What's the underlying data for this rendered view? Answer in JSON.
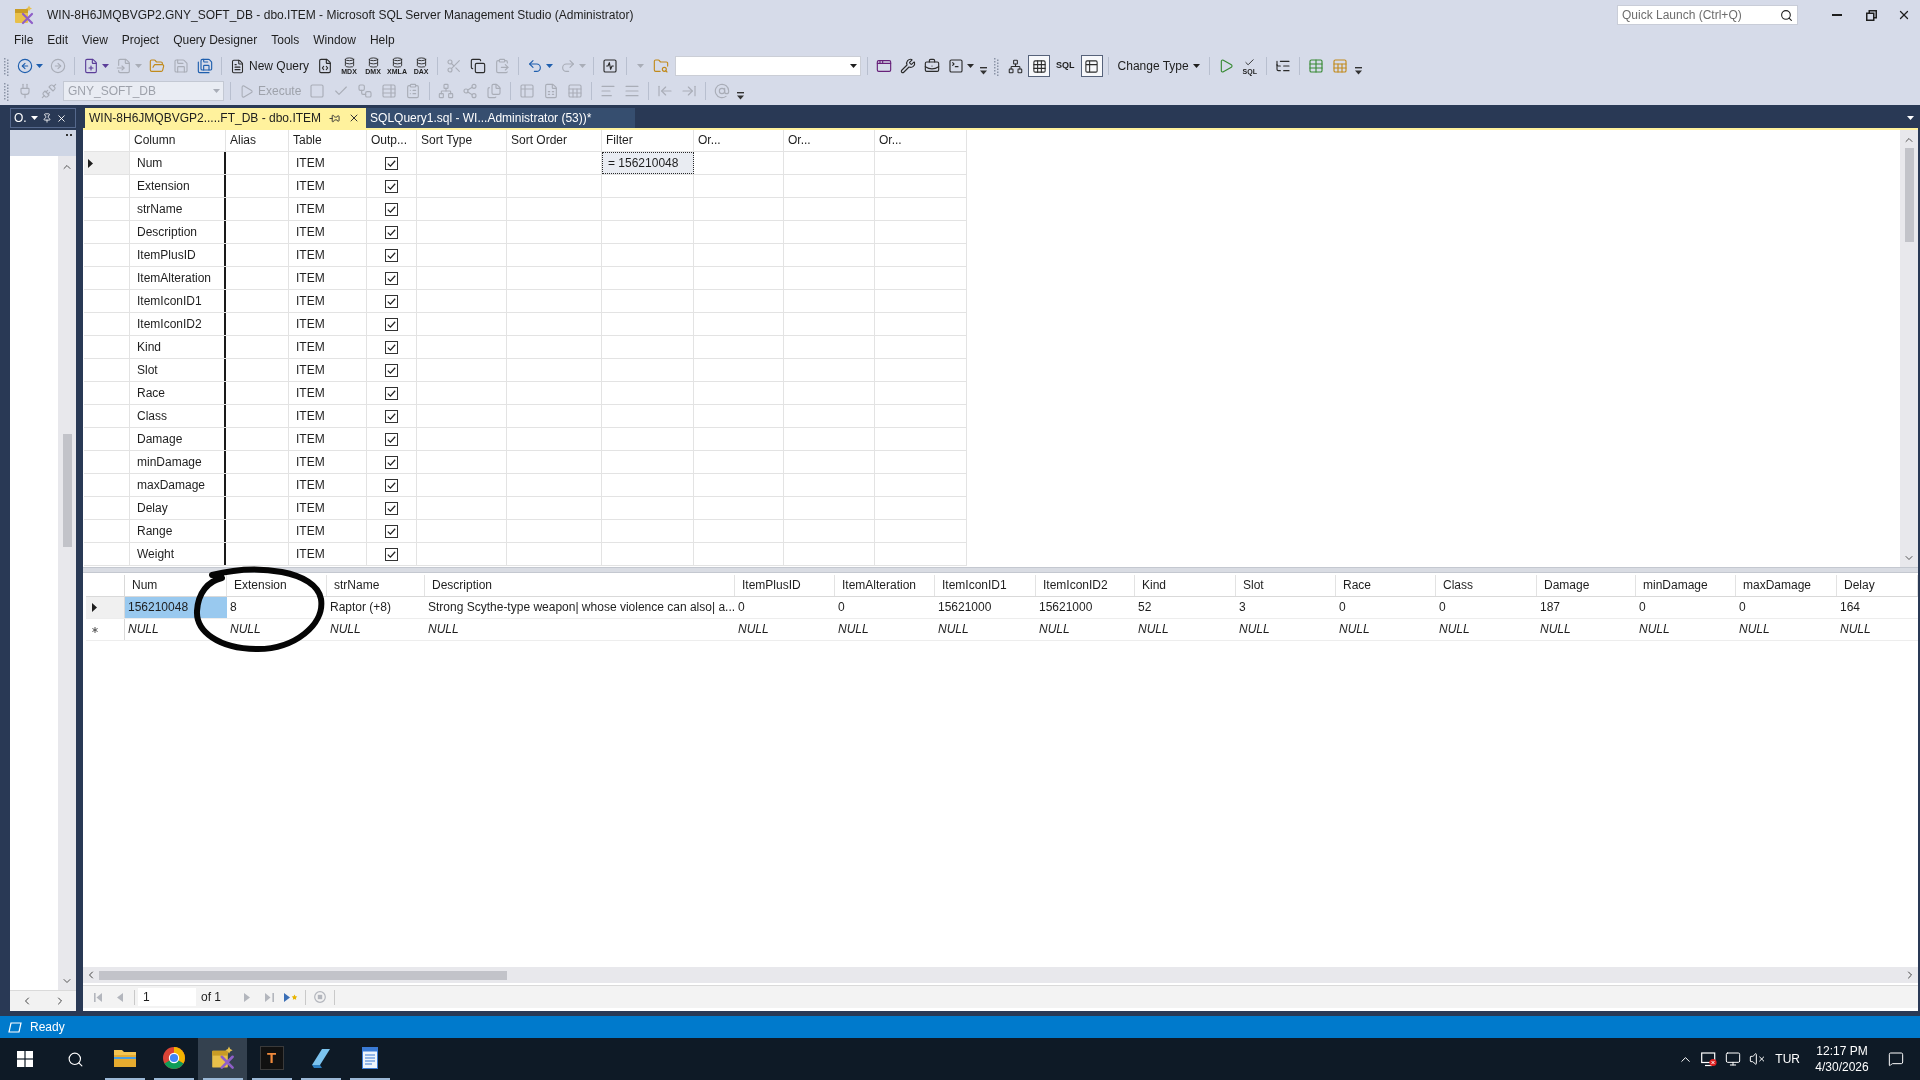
{
  "window": {
    "title": "WIN-8H6JMQBVGP2.GNY_SOFT_DB - dbo.ITEM - Microsoft SQL Server Management Studio (Administrator)",
    "quick_launch": {
      "placeholder": "Quick Launch (Ctrl+Q)"
    }
  },
  "menu": [
    {
      "label": "File"
    },
    {
      "label": "Edit"
    },
    {
      "label": "View"
    },
    {
      "label": "Project"
    },
    {
      "label": "Query Designer"
    },
    {
      "label": "Tools"
    },
    {
      "label": "Window"
    },
    {
      "label": "Help"
    }
  ],
  "standard_toolbar": [
    [
      {
        "kind": "split",
        "disabled": false
      },
      {
        "kind": "icon",
        "disabled": true
      }
    ],
    [
      {
        "kind": "split",
        "disabled": false
      },
      {
        "kind": "split",
        "disabled": true
      },
      {
        "kind": "icon",
        "disabled": false
      },
      {
        "kind": "icon",
        "disabled": true
      },
      {
        "kind": "icon",
        "disabled": false
      }
    ],
    [
      {
        "kind": "button",
        "label": "New Query",
        "disabled": false
      },
      {
        "kind": "icon",
        "disabled": false
      },
      {
        "kind": "icon",
        "badge": "MDX",
        "disabled": false
      },
      {
        "kind": "icon",
        "badge": "DMX",
        "disabled": false
      },
      {
        "kind": "icon",
        "badge": "XMLA",
        "disabled": false
      },
      {
        "kind": "icon",
        "badge": "DAX",
        "disabled": false
      }
    ],
    [
      {
        "kind": "icon",
        "disabled": true
      },
      {
        "kind": "icon",
        "disabled": false
      },
      {
        "kind": "icon",
        "disabled": true
      }
    ],
    [
      {
        "kind": "split",
        "disabled": false
      },
      {
        "kind": "split",
        "disabled": true
      }
    ],
    [
      {
        "kind": "icon",
        "disabled": false
      }
    ],
    [
      {
        "kind": "menu",
        "disabled": true
      },
      {
        "kind": "icon",
        "disabled": false
      },
      {
        "kind": "combo",
        "disabled": false
      }
    ],
    [
      {
        "kind": "icon",
        "disabled": false
      },
      {
        "kind": "icon",
        "disabled": false
      },
      {
        "kind": "icon",
        "disabled": false
      },
      {
        "kind": "split",
        "disabled": false
      }
    ]
  ],
  "designer_toolbar": [
    [
      {
        "kind": "icon",
        "pressed": false
      },
      {
        "kind": "icon",
        "pressed": true
      },
      {
        "kind": "text",
        "label": "SQL",
        "pressed": false
      },
      {
        "kind": "icon",
        "pressed": true
      }
    ],
    [
      {
        "kind": "menu-button",
        "label": "Change Type"
      }
    ],
    [
      {
        "kind": "icon"
      },
      {
        "kind": "icon",
        "badge": "SQL"
      }
    ],
    [
      {
        "kind": "icon"
      }
    ],
    [
      {
        "kind": "icon"
      },
      {
        "kind": "icon"
      }
    ]
  ],
  "sql_toolbar": [
    [
      {
        "kind": "icon",
        "disabled": true
      },
      {
        "kind": "icon",
        "disabled": true
      },
      {
        "kind": "combo",
        "value": "GNY_SOFT_DB",
        "disabled": true
      }
    ],
    [
      {
        "kind": "button",
        "label": "Execute",
        "disabled": true
      },
      {
        "kind": "icon",
        "disabled": true
      },
      {
        "kind": "icon",
        "disabled": true
      },
      {
        "kind": "icon",
        "disabled": true
      },
      {
        "kind": "icon",
        "disabled": true
      },
      {
        "kind": "icon",
        "disabled": true
      }
    ],
    [
      {
        "kind": "icon",
        "disabled": true
      },
      {
        "kind": "icon",
        "disabled": true
      },
      {
        "kind": "icon",
        "disabled": true
      }
    ],
    [
      {
        "kind": "icon",
        "disabled": true
      },
      {
        "kind": "icon",
        "disabled": true
      },
      {
        "kind": "icon",
        "disabled": true
      }
    ],
    [
      {
        "kind": "icon",
        "disabled": true
      },
      {
        "kind": "icon",
        "disabled": true
      }
    ],
    [
      {
        "kind": "icon",
        "disabled": true
      },
      {
        "kind": "icon",
        "disabled": true
      }
    ],
    [
      {
        "kind": "icon",
        "disabled": true
      }
    ]
  ],
  "tool_window": {
    "title": "O."
  },
  "document_tabs": [
    {
      "label": "WIN-8H6JMQBVGP2.....FT_DB - dbo.ITEM",
      "selected": true
    },
    {
      "label": "SQLQuery1.sql - WI...Administrator (53))*",
      "selected": false
    }
  ],
  "criteria_grid": {
    "columns": [
      "Column",
      "Alias",
      "Table",
      "Outp...",
      "Sort Type",
      "Sort Order",
      "Filter",
      "Or...",
      "Or...",
      "Or..."
    ],
    "rows": [
      {
        "column": "Num",
        "table": "ITEM",
        "output": true,
        "current": true,
        "filter": {
          "value": "= 156210048",
          "focused": true
        }
      },
      {
        "column": "Extension",
        "table": "ITEM",
        "output": true,
        "current": false
      },
      {
        "column": "strName",
        "table": "ITEM",
        "output": true,
        "current": false
      },
      {
        "column": "Description",
        "table": "ITEM",
        "output": true,
        "current": false
      },
      {
        "column": "ItemPlusID",
        "table": "ITEM",
        "output": true,
        "current": false
      },
      {
        "column": "ItemAlteration",
        "table": "ITEM",
        "output": true,
        "current": false
      },
      {
        "column": "ItemIconID1",
        "table": "ITEM",
        "output": true,
        "current": false
      },
      {
        "column": "ItemIconID2",
        "table": "ITEM",
        "output": true,
        "current": false
      },
      {
        "column": "Kind",
        "table": "ITEM",
        "output": true,
        "current": false
      },
      {
        "column": "Slot",
        "table": "ITEM",
        "output": true,
        "current": false
      },
      {
        "column": "Race",
        "table": "ITEM",
        "output": true,
        "current": false
      },
      {
        "column": "Class",
        "table": "ITEM",
        "output": true,
        "current": false
      },
      {
        "column": "Damage",
        "table": "ITEM",
        "output": true,
        "current": false
      },
      {
        "column": "minDamage",
        "table": "ITEM",
        "output": true,
        "current": false
      },
      {
        "column": "maxDamage",
        "table": "ITEM",
        "output": true,
        "current": false
      },
      {
        "column": "Delay",
        "table": "ITEM",
        "output": true,
        "current": false
      },
      {
        "column": "Range",
        "table": "ITEM",
        "output": true,
        "current": false
      },
      {
        "column": "Weight",
        "table": "ITEM",
        "output": true,
        "current": false
      }
    ]
  },
  "results_grid": {
    "columns": [
      "Num",
      "Extension",
      "strName",
      "Description",
      "ItemPlusID",
      "ItemAlteration",
      "ItemIconID1",
      "ItemIconID2",
      "Kind",
      "Slot",
      "Race",
      "Class",
      "Damage",
      "minDamage",
      "maxDamage",
      "Delay"
    ],
    "rows": [
      {
        "kind": "data",
        "current": true,
        "cells": [
          {
            "value": "156210048",
            "selected": true
          },
          {
            "value": "8",
            "selected": false
          },
          {
            "value": "Raptor (+8)",
            "selected": false
          },
          {
            "value": "Strong Scythe-type weapon| whose violence can also| a...",
            "selected": false
          },
          {
            "value": "0",
            "selected": false
          },
          {
            "value": "0",
            "selected": false
          },
          {
            "value": "15621000",
            "selected": false
          },
          {
            "value": "15621000",
            "selected": false
          },
          {
            "value": "52",
            "selected": false
          },
          {
            "value": "3",
            "selected": false
          },
          {
            "value": "0",
            "selected": false
          },
          {
            "value": "0",
            "selected": false
          },
          {
            "value": "187",
            "selected": false
          },
          {
            "value": "0",
            "selected": false
          },
          {
            "value": "0",
            "selected": false
          },
          {
            "value": "164",
            "selected": false
          }
        ]
      },
      {
        "kind": "new",
        "current": false,
        "cells": [
          {
            "value": "NULL",
            "selected": false
          },
          {
            "value": "NULL",
            "selected": false
          },
          {
            "value": "NULL",
            "selected": false
          },
          {
            "value": "NULL",
            "selected": false
          },
          {
            "value": "NULL",
            "selected": false
          },
          {
            "value": "NULL",
            "selected": false
          },
          {
            "value": "NULL",
            "selected": false
          },
          {
            "value": "NULL",
            "selected": false
          },
          {
            "value": "NULL",
            "selected": false
          },
          {
            "value": "NULL",
            "selected": false
          },
          {
            "value": "NULL",
            "selected": false
          },
          {
            "value": "NULL",
            "selected": false
          },
          {
            "value": "NULL",
            "selected": false
          },
          {
            "value": "NULL",
            "selected": false
          },
          {
            "value": "NULL",
            "selected": false
          },
          {
            "value": "NULL",
            "selected": false
          }
        ]
      }
    ]
  },
  "pager": {
    "page": "1",
    "count": "of 1",
    "buttons": [
      {
        "disabled": true
      },
      {
        "disabled": true
      },
      {
        "disabled": true
      },
      {
        "disabled": true
      },
      {
        "disabled": false
      },
      {
        "disabled": true
      }
    ]
  },
  "status_bar": {
    "text": "Ready"
  },
  "taskbar": {
    "apps": [
      {
        "running": true,
        "active": false
      },
      {
        "running": true,
        "active": false
      },
      {
        "running": true,
        "active": true
      },
      {
        "running": true,
        "active": false,
        "letter": "T"
      },
      {
        "running": true,
        "active": false
      },
      {
        "running": true,
        "active": false
      }
    ],
    "tray": {
      "language": "TUR",
      "time": "12:17 PM",
      "date": "4/30/2026"
    }
  }
}
